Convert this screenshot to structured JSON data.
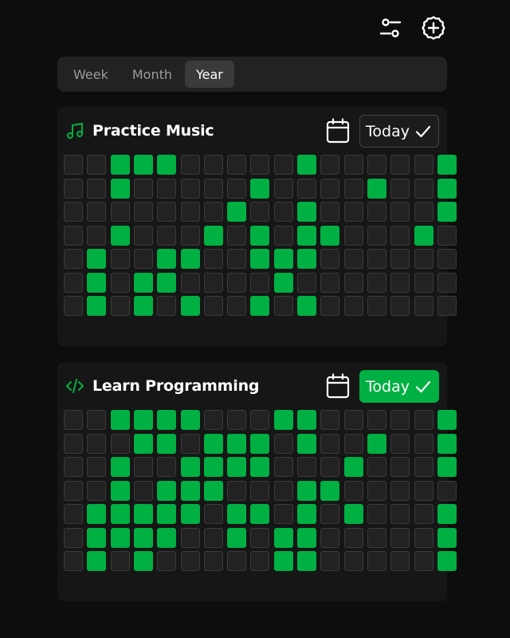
{
  "toolbar": {
    "filter_icon": "sliders-icon",
    "add_icon": "plus-circle-icon"
  },
  "tabs": [
    {
      "label": "Week",
      "active": false
    },
    {
      "label": "Month",
      "active": false
    },
    {
      "label": "Year",
      "active": true
    }
  ],
  "colors": {
    "background": "#0d0d0d",
    "card": "#161616",
    "accent": "#00b043",
    "empty_cell": "#222222"
  },
  "habits": [
    {
      "icon": "music-note-icon",
      "title": "Practice Music",
      "today_label": "Today",
      "done_today": false,
      "grid": [
        [
          0,
          0,
          1,
          1,
          1,
          0,
          0,
          0,
          0,
          0,
          1,
          0,
          0,
          0,
          0,
          0,
          1
        ],
        [
          0,
          0,
          1,
          0,
          0,
          0,
          0,
          0,
          1,
          0,
          0,
          0,
          0,
          1,
          0,
          0,
          1
        ],
        [
          0,
          0,
          0,
          0,
          0,
          0,
          0,
          1,
          0,
          0,
          1,
          0,
          0,
          0,
          0,
          0,
          1
        ],
        [
          0,
          0,
          1,
          0,
          0,
          0,
          1,
          0,
          1,
          0,
          1,
          1,
          0,
          0,
          0,
          1,
          0
        ],
        [
          0,
          1,
          0,
          0,
          1,
          1,
          0,
          0,
          1,
          1,
          1,
          0,
          0,
          0,
          0,
          0,
          0
        ],
        [
          0,
          1,
          0,
          1,
          1,
          0,
          0,
          0,
          0,
          1,
          0,
          0,
          0,
          0,
          0,
          0,
          0
        ],
        [
          0,
          1,
          0,
          1,
          0,
          1,
          0,
          0,
          1,
          0,
          1,
          0,
          0,
          0,
          0,
          0,
          0
        ]
      ]
    },
    {
      "icon": "code-icon",
      "title": "Learn Programming",
      "today_label": "Today",
      "done_today": true,
      "grid": [
        [
          0,
          0,
          1,
          1,
          1,
          1,
          0,
          0,
          0,
          1,
          1,
          0,
          0,
          0,
          0,
          0,
          1
        ],
        [
          0,
          0,
          0,
          1,
          1,
          0,
          1,
          1,
          1,
          0,
          1,
          0,
          0,
          1,
          0,
          0,
          1
        ],
        [
          0,
          0,
          1,
          0,
          0,
          1,
          1,
          1,
          1,
          0,
          0,
          0,
          1,
          0,
          0,
          0,
          1
        ],
        [
          0,
          0,
          1,
          0,
          1,
          1,
          1,
          0,
          0,
          0,
          1,
          1,
          0,
          0,
          0,
          0,
          0
        ],
        [
          0,
          1,
          1,
          1,
          1,
          1,
          0,
          1,
          1,
          0,
          1,
          0,
          1,
          0,
          0,
          0,
          1
        ],
        [
          0,
          1,
          1,
          1,
          1,
          0,
          0,
          1,
          0,
          1,
          1,
          0,
          0,
          0,
          0,
          0,
          1
        ],
        [
          0,
          1,
          0,
          1,
          0,
          0,
          0,
          0,
          0,
          1,
          1,
          0,
          0,
          0,
          0,
          0,
          1
        ]
      ]
    }
  ]
}
